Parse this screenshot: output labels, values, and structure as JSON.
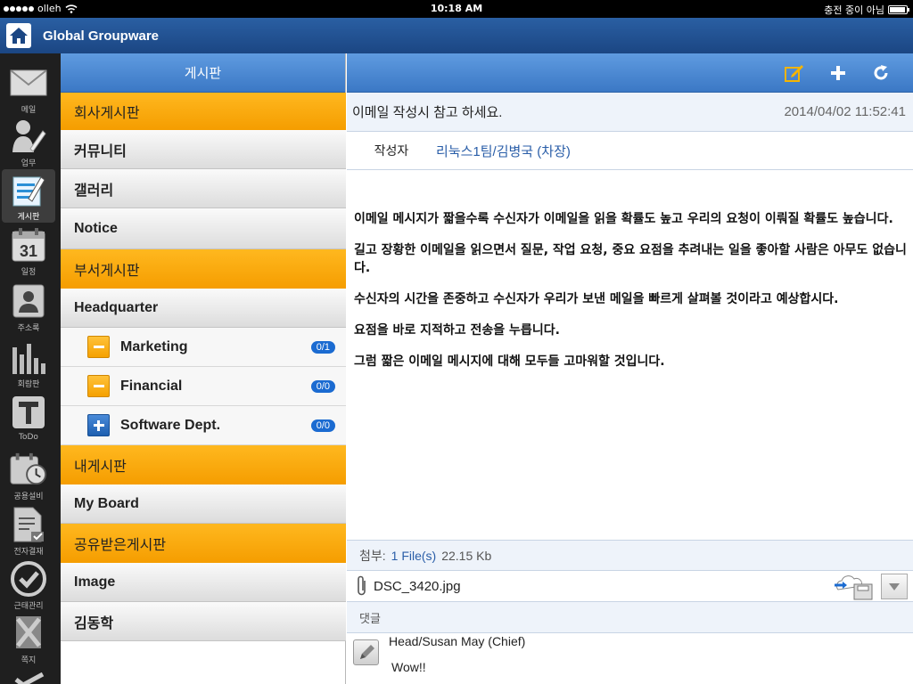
{
  "status": {
    "carrier": "olleh",
    "time": "10:18 AM",
    "right_text": "충전 중이 아님"
  },
  "app": {
    "title": "Global Groupware"
  },
  "dock": [
    {
      "id": "mail",
      "label": "메일",
      "icon": "envelope-icon"
    },
    {
      "id": "work",
      "label": "업무",
      "icon": "user-pen-icon"
    },
    {
      "id": "board",
      "label": "게시판",
      "icon": "board-edit-icon",
      "active": true
    },
    {
      "id": "calendar",
      "label": "일정",
      "icon": "calendar-icon",
      "day": "31"
    },
    {
      "id": "contacts",
      "label": "주소록",
      "icon": "contact-card-icon"
    },
    {
      "id": "survey",
      "label": "회람판",
      "icon": "bar-chart-icon"
    },
    {
      "id": "todo",
      "label": "ToDo",
      "icon": "todo-t-icon"
    },
    {
      "id": "facility",
      "label": "공용설비",
      "icon": "calendar-clock-icon"
    },
    {
      "id": "approval",
      "label": "전자결재",
      "icon": "document-check-icon"
    },
    {
      "id": "attendance",
      "label": "근태관리",
      "icon": "check-circle-icon"
    },
    {
      "id": "note",
      "label": "쪽지",
      "icon": "note-x-icon"
    }
  ],
  "boards": {
    "title": "게시판",
    "rows": [
      {
        "type": "cat",
        "label": "회사게시판"
      },
      {
        "type": "grp",
        "label": "커뮤니티"
      },
      {
        "type": "grp",
        "label": "갤러리"
      },
      {
        "type": "grp",
        "label": "Notice"
      },
      {
        "type": "cat",
        "label": "부서게시판"
      },
      {
        "type": "grp",
        "label": "Headquarter"
      },
      {
        "type": "sub",
        "label": "Marketing",
        "toggle": "minus",
        "badge": "0/1"
      },
      {
        "type": "sub",
        "label": "Financial",
        "toggle": "minus",
        "badge": "0/0"
      },
      {
        "type": "sub",
        "label": "Software Dept.",
        "toggle": "plus",
        "badge": "0/0"
      },
      {
        "type": "cat",
        "label": "내게시판"
      },
      {
        "type": "grp",
        "label": "My Board"
      },
      {
        "type": "cat",
        "label": "공유받은게시판"
      },
      {
        "type": "grp",
        "label": "Image"
      },
      {
        "type": "grp",
        "label": "김동학"
      }
    ]
  },
  "post": {
    "subject": "이메일 작성시 참고 하세요.",
    "date": "2014/04/02 11:52:41",
    "author_label": "작성자",
    "author": "리눅스1팀/김병국 (차장)",
    "paragraphs": [
      "이메일 메시지가 짧을수록 수신자가 이메일을 읽을 확률도 높고 우리의 요청이 이뤄질 확률도 높습니다.",
      "길고 장황한 이메일을 읽으면서 질문, 작업 요청, 중요 요점을 추려내는 일을 좋아할 사람은 아무도 없습니다.",
      "수신자의 시간을 존중하고 수신자가 우리가 보낸 메일을 빠르게 살펴볼 것이라고 예상합시다.",
      "요점을 바로 지적하고 전송을 누릅니다.",
      "그럼 짧은 이메일 메시지에 대해 모두들 고마워할 것입니다."
    ],
    "attachment": {
      "label": "첨부:",
      "count": "1 File(s)",
      "size": "22.15 Kb",
      "file_name": "DSC_3420.jpg"
    },
    "comments_label": "댓글",
    "comments": [
      {
        "author": "Head/Susan May (Chief)",
        "text": "Wow!!"
      }
    ]
  },
  "colors": {
    "accent_orange": "#f5a100",
    "header_blue": "#3b78c5",
    "link_blue": "#2a5ea8",
    "badge_blue": "#1b6bd1"
  }
}
